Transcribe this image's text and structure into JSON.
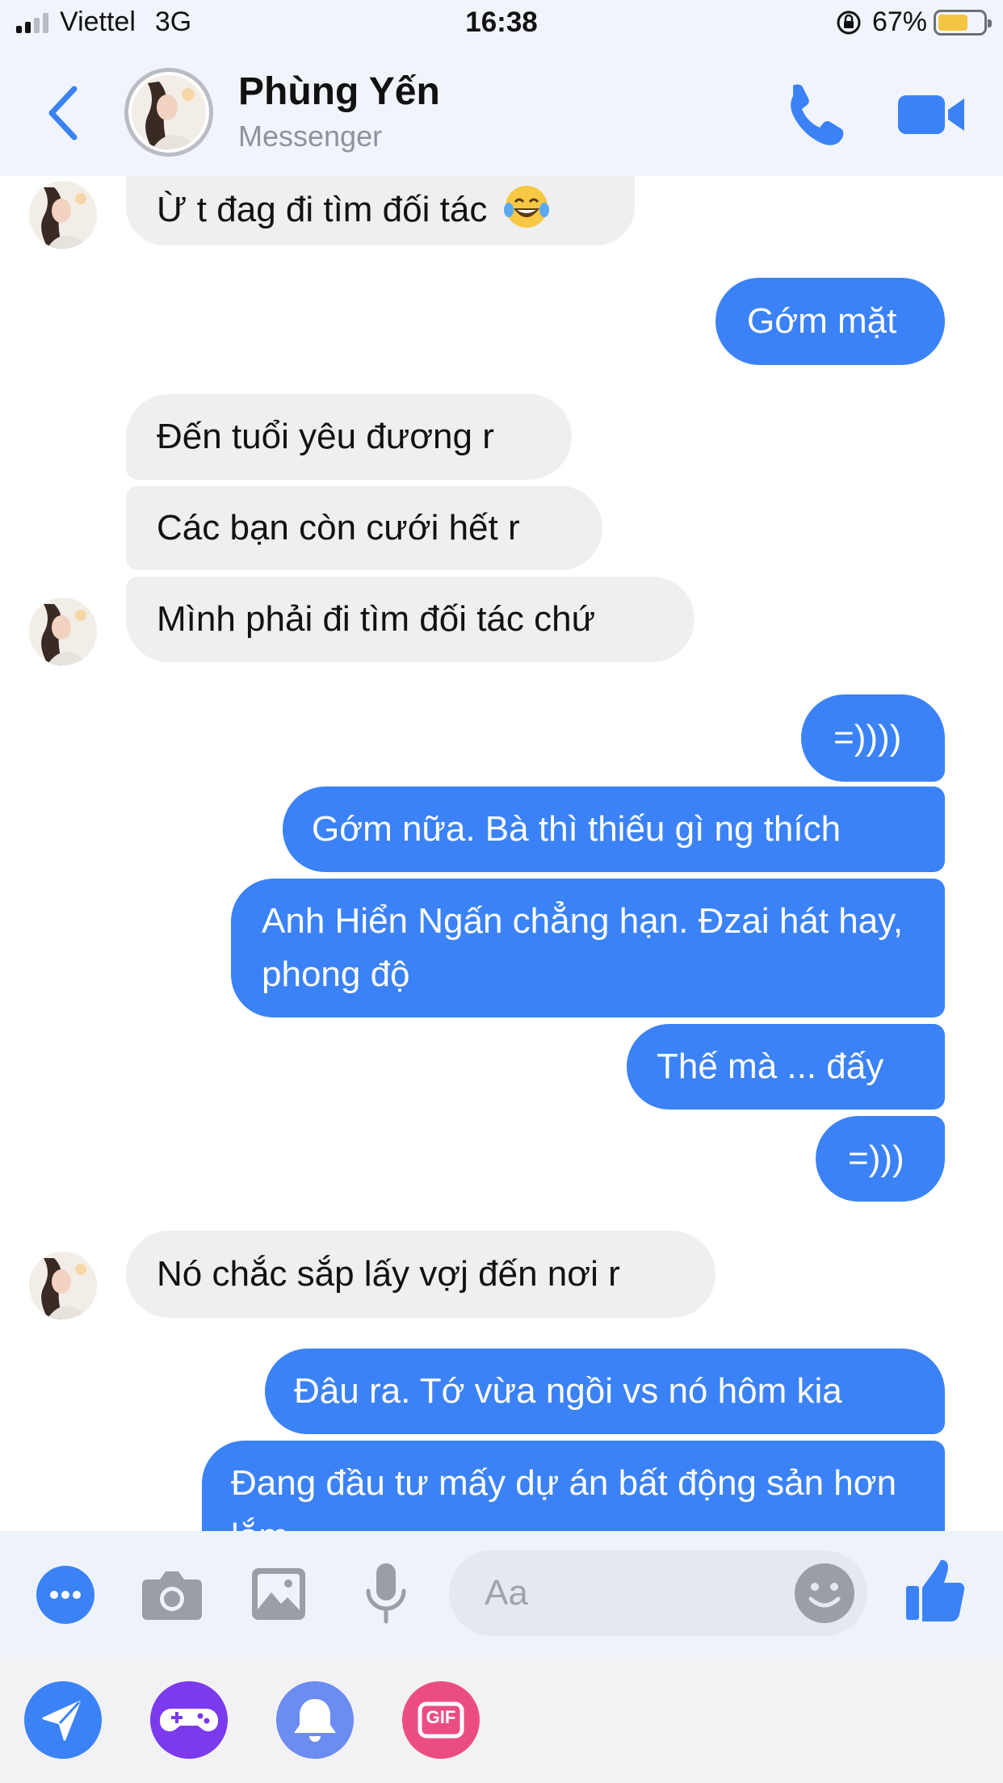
{
  "status_bar": {
    "carrier": "Viettel",
    "network": "3G",
    "time": "16:38",
    "battery": "67%",
    "battery_level": 0.67
  },
  "header": {
    "contact_name": "Phùng Yến",
    "subtitle": "Messenger"
  },
  "messages": [
    {
      "side": "in",
      "text": "Ừ t đag đi tìm đối tác",
      "emoji": "laughing-tears-emoji"
    },
    {
      "side": "out",
      "text": "Gớm mặt"
    },
    {
      "side": "in",
      "text": "Đến tuổi yêu đương r"
    },
    {
      "side": "in",
      "text": "Các bạn còn cưới hết r"
    },
    {
      "side": "in",
      "text": "Mình phải đi tìm đối tác chứ"
    },
    {
      "side": "out",
      "text": "=))))"
    },
    {
      "side": "out",
      "text": "Gớm nữa. Bà thì thiếu gì ng thích"
    },
    {
      "side": "out",
      "text": "Anh Hiển Ngấn chẳng hạn. Đzai hát hay, phong độ"
    },
    {
      "side": "out",
      "text": "Thế mà ... đấy"
    },
    {
      "side": "out",
      "text": "=)))"
    },
    {
      "side": "in",
      "text": "Nó chắc sắp lấy vợj đến nơi r"
    },
    {
      "side": "out",
      "text": "Đâu ra. Tớ vừa ngồi vs nó hôm kia"
    },
    {
      "side": "out",
      "text": "Đang đầu tư mấy dự án bất động sản hơn lắm"
    }
  ],
  "composer": {
    "placeholder": "Aa"
  },
  "tray": {
    "gif_label": "GIF"
  },
  "colors": {
    "accent": "#3b82f6",
    "incoming_bubble": "#efefef",
    "header_bg": "#f1f5fb",
    "game_purple": "#7c3aed",
    "bell_blue": "#6b8cf0",
    "gif_pink": "#ec4d80"
  }
}
